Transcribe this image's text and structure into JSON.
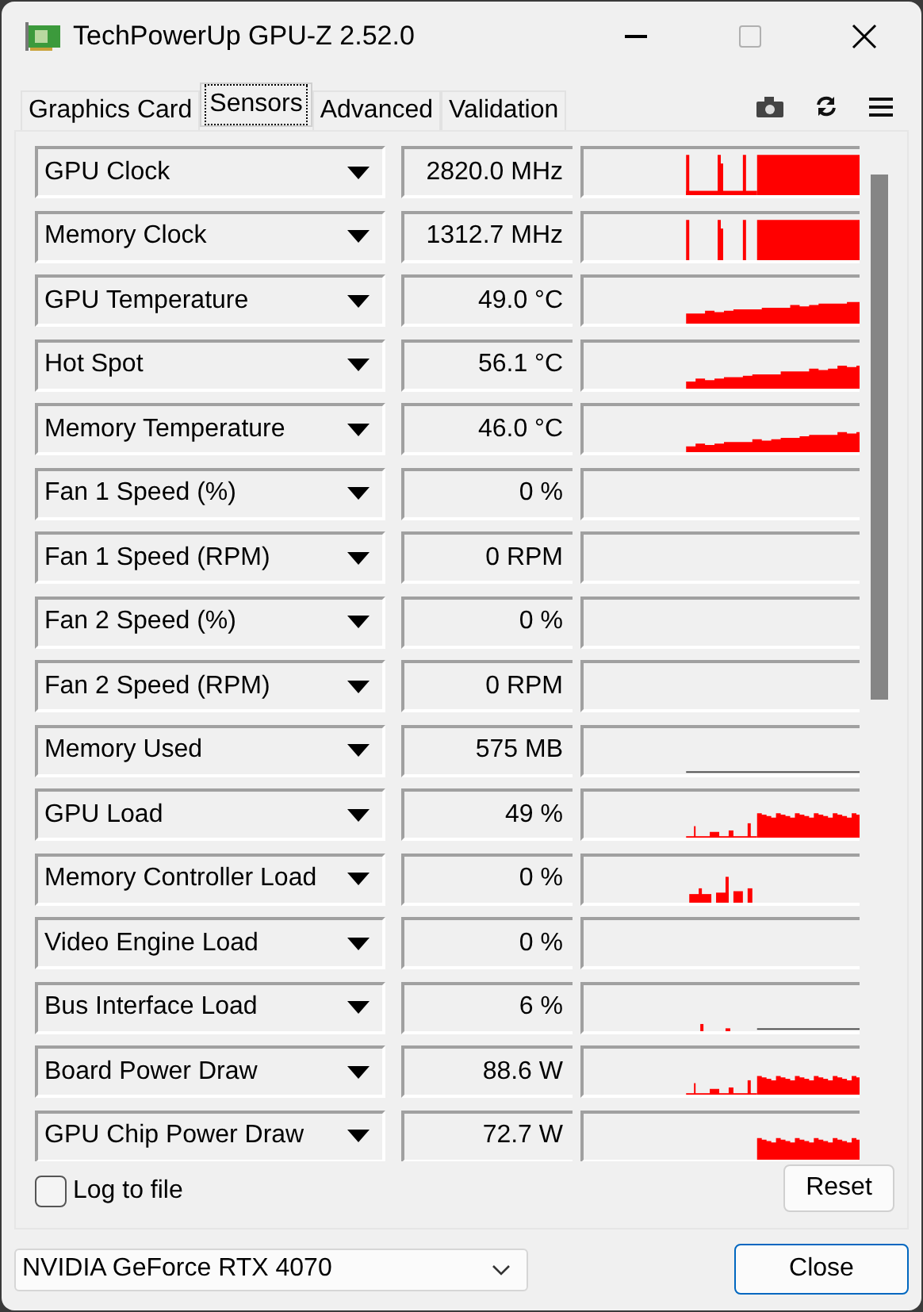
{
  "window": {
    "title": "TechPowerUp GPU-Z 2.52.0"
  },
  "tabs": [
    {
      "label": "Graphics Card",
      "selected": false
    },
    {
      "label": "Sensors",
      "selected": true
    },
    {
      "label": "Advanced",
      "selected": false
    },
    {
      "label": "Validation",
      "selected": false
    }
  ],
  "sensors": [
    {
      "name": "GPU Clock",
      "value": "2820.0 MHz",
      "kind": "clock"
    },
    {
      "name": "Memory Clock",
      "value": "1312.7 MHz",
      "kind": "clock2"
    },
    {
      "name": "GPU Temperature",
      "value": "49.0 °C",
      "kind": "temp"
    },
    {
      "name": "Hot Spot",
      "value": "56.1 °C",
      "kind": "temp2"
    },
    {
      "name": "Memory Temperature",
      "value": "46.0 °C",
      "kind": "temp3"
    },
    {
      "name": "Fan 1 Speed (%)",
      "value": "0 %",
      "kind": "empty"
    },
    {
      "name": "Fan 1 Speed (RPM)",
      "value": "0 RPM",
      "kind": "empty"
    },
    {
      "name": "Fan 2 Speed (%)",
      "value": "0 %",
      "kind": "empty"
    },
    {
      "name": "Fan 2 Speed (RPM)",
      "value": "0 RPM",
      "kind": "empty"
    },
    {
      "name": "Memory Used",
      "value": "575 MB",
      "kind": "line"
    },
    {
      "name": "GPU Load",
      "value": "49 %",
      "kind": "load"
    },
    {
      "name": "Memory Controller Load",
      "value": "0 %",
      "kind": "controller"
    },
    {
      "name": "Video Engine Load",
      "value": "0 %",
      "kind": "empty"
    },
    {
      "name": "Bus Interface Load",
      "value": "6 %",
      "kind": "bus"
    },
    {
      "name": "Board Power Draw",
      "value": "88.6 W",
      "kind": "power"
    },
    {
      "name": "GPU Chip Power Draw",
      "value": "72.7 W",
      "kind": "power2"
    }
  ],
  "log_to_file": {
    "label": "Log to file",
    "checked": false
  },
  "reset_button": "Reset",
  "device": {
    "value": "NVIDIA GeForce RTX 4070"
  },
  "close_button": "Close"
}
